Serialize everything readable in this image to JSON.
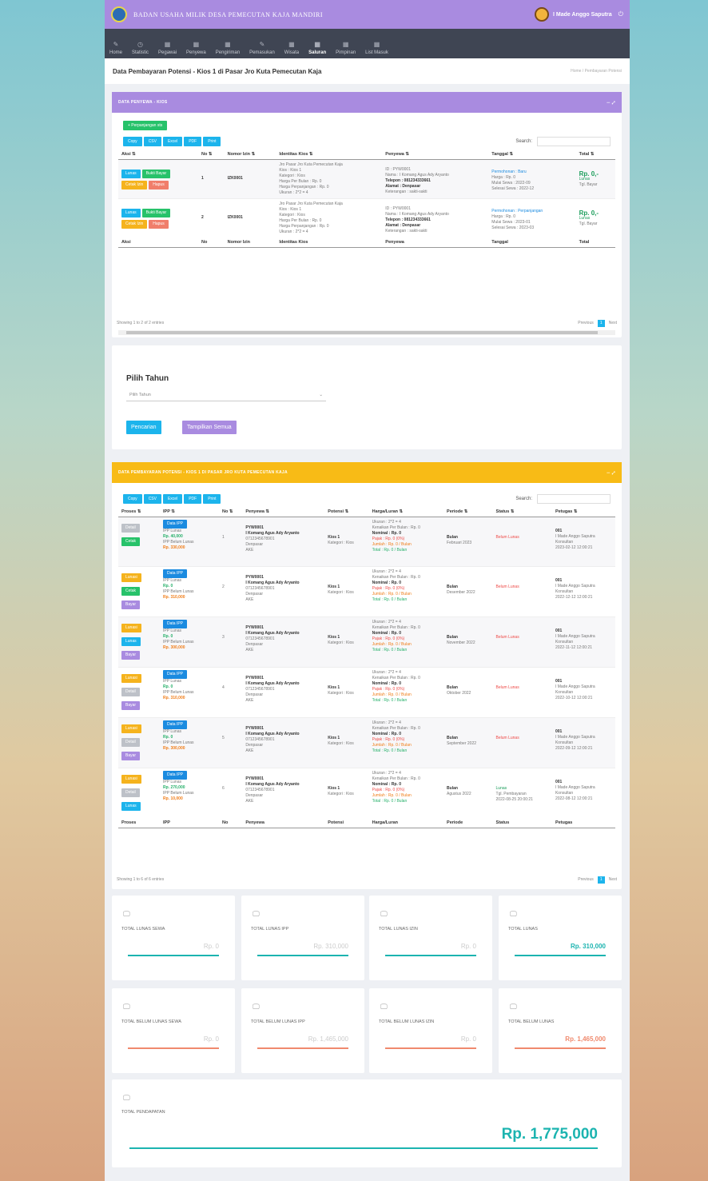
{
  "app": {
    "brand": "BADAN USAHA MILIK DESA PEMECUTAN KAJA MANDIRI",
    "user": "I Made Anggo Saputra"
  },
  "nav": [
    {
      "label": "Home",
      "icon": "✎"
    },
    {
      "label": "Statistic",
      "icon": "◷"
    },
    {
      "label": "Pegawai",
      "icon": "▦"
    },
    {
      "label": "Penyewa",
      "icon": "▦"
    },
    {
      "label": "Pengiriman",
      "icon": "▦"
    },
    {
      "label": "Pemasukan",
      "icon": "✎"
    },
    {
      "label": "Wisata",
      "icon": "▦"
    },
    {
      "label": "Saluran",
      "icon": "▦"
    },
    {
      "label": "Pimpinan",
      "icon": "▦"
    },
    {
      "label": "List Masuk",
      "icon": "▦"
    }
  ],
  "page": {
    "title": "Data Pembayaran Potensi - Kios 1 di Pasar Jro Kuta Pemecutan Kaja",
    "crumb": "Home  /  Pembayaran Potensi"
  },
  "card1": {
    "title": "DATA PENYEWA - KIOS",
    "add_btn": "+ Perpanjangan sts",
    "export": [
      "Copy",
      "CSV",
      "Excel",
      "PDF",
      "Print"
    ],
    "search": "Search:",
    "headers": [
      "Aksi",
      "No",
      "Nomor Izin",
      "Identitas Kios",
      "Penyewa",
      "Tanggal",
      "Total"
    ],
    "footers": [
      "Aksi",
      "No",
      "Nomor Izin",
      "Identitas Kios",
      "Penyewa",
      "Tanggal",
      "Total"
    ],
    "btns": {
      "lunas": "Lunas",
      "bukti": "Bukti Bayar",
      "cetak": "Cetak Izin",
      "hapus": "Hapus"
    },
    "rows": [
      {
        "no": "1",
        "izin": "IZK0001",
        "loc": "Jro Pasar Jro Kuta Pemecutan Kaja",
        "kios": "Kios : Kios 1",
        "kat": "Kategori : Kios",
        "sewa": "Harga Per Bulan : Rp. 0",
        "ppp": "Harga Perpanjangan : Rp. 0",
        "ukuran": "Ukuran : 2*2 = 4",
        "pid": "ID : PYW0001",
        "pnama": "Nama : I Komang Agus Ady Aryanto",
        "ptelp": "Telepon : 081234333661",
        "palamat": "Alamat : Denpasar",
        "pket": "Keterangan : sakti-sakti",
        "t1": "Permohonan : Baru",
        "t2": "Harga : Rp. 0",
        "t3": "Mulai Sewa : 2022-09",
        "t4": "Selesai Sewa : 2022-12",
        "total": "Rp. 0,-",
        "status": "Lunas",
        "ket": "Tgl. Bayar"
      },
      {
        "no": "2",
        "izin": "IZK0001",
        "loc": "Jro Pasar Jro Kuta Pemecutan Kaja",
        "kios": "Kios : Kios 1",
        "kat": "Kategori : Kios",
        "sewa": "Harga Per Bulan : Rp. 0",
        "ppp": "Harga Perpanjangan : Rp. 0",
        "ukuran": "Ukuran : 2*2 = 4",
        "pid": "ID : PYW0001",
        "pnama": "Nama : I Komang Agus Ady Aryanto",
        "ptelp": "Telepon : 081234333661",
        "palamat": "Alamat : Denpasar",
        "pket": "Keterangan : sakti-sakti",
        "t1": "Permohonan : Perpanjangan",
        "t2": "Harga : Rp. 0",
        "t3": "Mulai Sewa : 2023-01",
        "t4": "Selesai Sewa : 2023-03",
        "total": "Rp. 0,-",
        "status": "Lunas",
        "ket": "Tgl. Bayar"
      }
    ],
    "showing": "Showing 1 to 2 of 2 entries",
    "prev": "Previous",
    "page": "1",
    "next": "Next"
  },
  "filter": {
    "title": "Pilih Tahun",
    "placeholder": "Pilih Tahun",
    "search_btn": "Pencarian",
    "all_btn": "Tampilkan Semua"
  },
  "card2": {
    "title": "DATA PEMBAYARAN POTENSI - KIOS 1 DI PASAR JRO KUTA PEMECUTAN KAJA",
    "export": [
      "Copy",
      "CSV",
      "Excel",
      "PDF",
      "Print"
    ],
    "search": "Search:",
    "headers": [
      "Proses",
      "IPP",
      "No",
      "Penyewa",
      "Potensi",
      "Harga/Luran",
      "Periode",
      "Status",
      "Petugas"
    ],
    "footers": [
      "Proses",
      "IPP",
      "No",
      "Penyewa",
      "Potensi",
      "Harga/Luran",
      "Periode",
      "Status",
      "Petugas"
    ],
    "btns": {
      "detail": "Detail",
      "cetak": "Cetak",
      "bayar": "Bayar",
      "lunas": "Lunas",
      "lunasi": "Lunasi",
      "ipp": "Data IPP"
    },
    "rows": [
      {
        "no": "1",
        "p": [
          "detail-g",
          "cetak"
        ],
        "ipp1": "IPP Lunas",
        "ipp2": "Rp. 40,000",
        "ipp3": "IPP Belum Lunas",
        "ipp4": "Rp. 330,000",
        "id": "PYW0001",
        "nama": "I Komang Agus Ady Aryanto",
        "telp": "0712345678901",
        "alamat": "Denpasar",
        "ket": "AKE",
        "potensi": "Kios 1",
        "kat": "Kategori : Kios",
        "uk": "Ukuran : 2*2 = 4",
        "pb": "Kenaikan Per Bulan : Rp. 0",
        "nom": "Nominal : Rp. 0",
        "pajak": "Pajak : Rp. 0 (0%)",
        "jml": "Jumlah : Rp. 0 / Bulan",
        "tot": "Total : Rp. 0 / Bulan",
        "per1": "Bulan",
        "per2": "Februari 2023",
        "status": "Belum Lunas",
        "pt1": "001",
        "pt2": "I Made Anggo Saputra",
        "pt3": "Konsultan",
        "pt4": "2023-02-12 12:00:21"
      },
      {
        "no": "2",
        "p": [
          "lunasi",
          "cetak",
          "bayar"
        ],
        "ipp1": "IPP Lunas",
        "ipp2": "Rp. 0",
        "ipp3": "IPP Belum Lunas",
        "ipp4": "Rp. 310,000",
        "id": "PYW0001",
        "nama": "I Komang Agus Ady Aryanto",
        "telp": "0712345678901",
        "alamat": "Denpasar",
        "ket": "AKE",
        "potensi": "Kios 1",
        "kat": "Kategori : Kios",
        "uk": "Ukuran : 2*2 = 4",
        "pb": "Kenaikan Per Bulan : Rp. 0",
        "nom": "Nominal : Rp. 0",
        "pajak": "Pajak : Rp. 0 (0%)",
        "jml": "Jumlah : Rp. 0 / Bulan",
        "tot": "Total : Rp. 0 / Bulan",
        "per1": "Bulan",
        "per2": "Desember 2022",
        "status": "Belum Lunas",
        "pt1": "001",
        "pt2": "I Made Anggo Saputra",
        "pt3": "Konsultan",
        "pt4": "2022-12-12 12:00:21"
      },
      {
        "no": "3",
        "p": [
          "lunasi",
          "lunas",
          "bayar"
        ],
        "ipp1": "IPP Lunas",
        "ipp2": "Rp. 0",
        "ipp3": "IPP Belum Lunas",
        "ipp4": "Rp. 300,000",
        "id": "PYW0001",
        "nama": "I Komang Agus Ady Aryanto",
        "telp": "0712345678901",
        "alamat": "Denpasar",
        "ket": "AKE",
        "potensi": "Kios 1",
        "kat": "Kategori : Kios",
        "uk": "Ukuran : 2*2 = 4",
        "pb": "Kenaikan Per Bulan : Rp. 0",
        "nom": "Nominal : Rp. 0",
        "pajak": "Pajak : Rp. 0 (0%)",
        "jml": "Jumlah : Rp. 0 / Bulan",
        "tot": "Total : Rp. 0 / Bulan",
        "per1": "Bulan",
        "per2": "November 2022",
        "status": "Belum Lunas",
        "pt1": "001",
        "pt2": "I Made Anggo Saputra",
        "pt3": "Konsultan",
        "pt4": "2022-11-12 12:00:21"
      },
      {
        "no": "4",
        "p": [
          "lunasi",
          "detail-g",
          "bayar"
        ],
        "ipp1": "IPP Lunas",
        "ipp2": "Rp. 0",
        "ipp3": "IPP Belum Lunas",
        "ipp4": "Rp. 310,000",
        "id": "PYW0001",
        "nama": "I Komang Agus Ady Aryanto",
        "telp": "0712345678901",
        "alamat": "Denpasar",
        "ket": "AKE",
        "potensi": "Kios 1",
        "kat": "Kategori : Kios",
        "uk": "Ukuran : 2*2 = 4",
        "pb": "Kenaikan Per Bulan : Rp. 0",
        "nom": "Nominal : Rp. 0",
        "pajak": "Pajak : Rp. 0 (0%)",
        "jml": "Jumlah : Rp. 0 / Bulan",
        "tot": "Total : Rp. 0 / Bulan",
        "per1": "Bulan",
        "per2": "Oktober 2022",
        "status": "Belum Lunas",
        "pt1": "001",
        "pt2": "I Made Anggo Saputra",
        "pt3": "Konsultan",
        "pt4": "2022-10-12 12:00:21"
      },
      {
        "no": "5",
        "p": [
          "lunasi",
          "detail-g",
          "bayar"
        ],
        "ipp1": "IPP Lunas",
        "ipp2": "Rp. 0",
        "ipp3": "IPP Belum Lunas",
        "ipp4": "Rp. 300,000",
        "id": "PYW0001",
        "nama": "I Komang Agus Ady Aryanto",
        "telp": "0712345678901",
        "alamat": "Denpasar",
        "ket": "AKE",
        "potensi": "Kios 1",
        "kat": "Kategori : Kios",
        "uk": "Ukuran : 2*2 = 4",
        "pb": "Kenaikan Per Bulan : Rp. 0",
        "nom": "Nominal : Rp. 0",
        "pajak": "Pajak : Rp. 0 (0%)",
        "jml": "Jumlah : Rp. 0 / Bulan",
        "tot": "Total : Rp. 0 / Bulan",
        "per1": "Bulan",
        "per2": "September 2022",
        "status": "Belum Lunas",
        "pt1": "001",
        "pt2": "I Made Anggo Saputra",
        "pt3": "Konsultan",
        "pt4": "2022-09-12 12:00:21"
      },
      {
        "no": "6",
        "p": [
          "lunasi",
          "detail-g",
          "lunas"
        ],
        "ipp1": "IPP Lunas",
        "ipp2": "Rp. 270,000",
        "ipp3": "IPP Belum Lunas",
        "ipp4": "Rp. 10,000",
        "id": "PYW0001",
        "nama": "I Komang Agus Ady Aryanto",
        "telp": "0712345678901",
        "alamat": "Denpasar",
        "ket": "AKE",
        "potensi": "Kios 1",
        "kat": "Kategori : Kios",
        "uk": "Ukuran : 2*2 = 4",
        "pb": "Kenaikan Per Bulan : Rp. 0",
        "nom": "Nominal : Rp. 0",
        "pajak": "Pajak : Rp. 0 (0%)",
        "jml": "Jumlah : Rp. 0 / Bulan",
        "tot": "Total : Rp. 0 / Bulan",
        "per1": "Bulan",
        "per2": "Agustus 2022",
        "status": "Lunas",
        "st2": "Tgl. Pembayaran",
        "st3": "2022-08-25 20:00:21",
        "pt1": "001",
        "pt2": "I Made Anggo Saputra",
        "pt3": "Konsultan",
        "pt4": "2022-08-12 12:00:21"
      }
    ],
    "showing": "Showing 1 to 6 of 6 entries",
    "prev": "Previous",
    "page": "1",
    "next": "Next"
  },
  "stats": [
    {
      "label": "TOTAL LUNAS SEWA",
      "value": "Rp. 0",
      "color": "#1cb4b0"
    },
    {
      "label": "TOTAL LUNAS IPP",
      "value": "Rp. 310,000",
      "color": "#1cb4b0"
    },
    {
      "label": "TOTAL LUNAS IZIN",
      "value": "Rp. 0",
      "color": "#1cb4b0"
    },
    {
      "label": "TOTAL LUNAS",
      "value": "Rp. 310,000",
      "color": "#1cb4b0"
    },
    {
      "label": "TOTAL BELUM LUNAS SEWA",
      "value": "Rp. 0",
      "color": "#f08a6e"
    },
    {
      "label": "TOTAL BELUM LUNAS IPP",
      "value": "Rp. 1,465,000",
      "color": "#f08a6e"
    },
    {
      "label": "TOTAL BELUM LUNAS IZIN",
      "value": "Rp. 0",
      "color": "#f08a6e"
    },
    {
      "label": "TOTAL BELUM LUNAS",
      "value": "Rp. 1,465,000",
      "color": "#f08a6e"
    }
  ],
  "pendapatan": {
    "label": "TOTAL PENDAPATAN",
    "value": "Rp. 1,775,000"
  }
}
